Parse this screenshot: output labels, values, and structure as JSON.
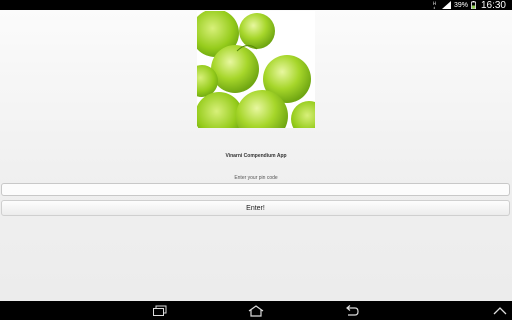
{
  "statusbar": {
    "battery_percent": "39%",
    "time": "16:30",
    "icons": [
      "network-icon",
      "signal-icon",
      "battery-icon"
    ]
  },
  "app": {
    "logo": "green-grapes-image",
    "title": "Vinarni Compendium App",
    "pin_label": "Enter your pin code",
    "pin_value": "",
    "enter_label": "Enter!"
  },
  "navbar": {
    "icons": [
      "recent-apps-icon",
      "home-icon",
      "back-icon",
      "menu-up-icon"
    ]
  },
  "colors": {
    "grape_green": "#a8d82a",
    "background": "#f2f2f2",
    "bars": "#000000"
  }
}
